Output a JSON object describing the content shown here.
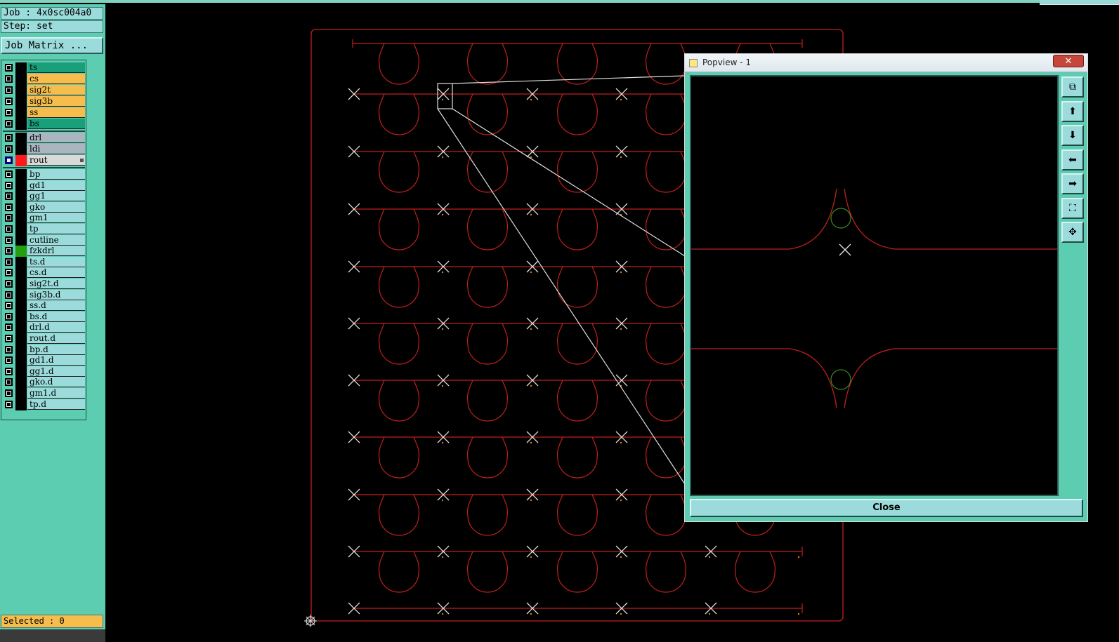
{
  "job_label": "Job : 4x0sc004a0",
  "step_label": "Step: set",
  "job_matrix_button": "Job Matrix ...",
  "layers_group1": [
    {
      "name": "ts",
      "color": "#19a07a"
    },
    {
      "name": "cs",
      "color": "#f7bd4c"
    },
    {
      "name": "sig2t",
      "color": "#f7bd4c"
    },
    {
      "name": "sig3b",
      "color": "#f7bd4c"
    },
    {
      "name": "ss",
      "color": "#f7bd4c"
    },
    {
      "name": "bs",
      "color": "#19a07a"
    }
  ],
  "layers_group2": [
    {
      "name": "drl",
      "color": "#a9b6c0"
    },
    {
      "name": "ldi",
      "color": "#a9b6c0"
    },
    {
      "name": "rout",
      "color": "#d9d9d9",
      "active": true,
      "swatch": "#ff1a1a"
    }
  ],
  "layers_group3": [
    {
      "name": "bp"
    },
    {
      "name": "gd1"
    },
    {
      "name": "gg1"
    },
    {
      "name": "gko"
    },
    {
      "name": "gm1"
    },
    {
      "name": "tp"
    },
    {
      "name": "cutline"
    },
    {
      "name": "fzkdrl",
      "swatch": "#22a010"
    },
    {
      "name": "ts.d"
    },
    {
      "name": "cs.d"
    },
    {
      "name": "sig2t.d"
    },
    {
      "name": "sig3b.d"
    },
    {
      "name": "ss.d"
    },
    {
      "name": "bs.d"
    },
    {
      "name": "drl.d"
    },
    {
      "name": "rout.d"
    },
    {
      "name": "bp.d"
    },
    {
      "name": "gd1.d"
    },
    {
      "name": "gg1.d"
    },
    {
      "name": "gko.d"
    },
    {
      "name": "gm1.d"
    },
    {
      "name": "tp.d"
    }
  ],
  "selected_label": "Selected : 0",
  "popview": {
    "title": "Popview - 1",
    "close_x": "✕",
    "close_button": "Close",
    "toolbar": [
      {
        "name": "zoom-window-icon",
        "glyph": "⧉"
      },
      {
        "name": "arrow-up-icon",
        "glyph": "⬆"
      },
      {
        "name": "arrow-down-icon",
        "glyph": "⬇"
      },
      {
        "name": "arrow-left-icon",
        "glyph": "⬅"
      },
      {
        "name": "arrow-right-icon",
        "glyph": "➡"
      },
      {
        "name": "zoom-fit-icon",
        "glyph": "⛶"
      },
      {
        "name": "zoom-center-icon",
        "glyph": "✥"
      }
    ]
  },
  "colors": {
    "rout_line": "#c0201c",
    "marker": "#e0e0e0",
    "pad_circle": "#3a8a20",
    "panel_bg": "#5ccdb1"
  }
}
